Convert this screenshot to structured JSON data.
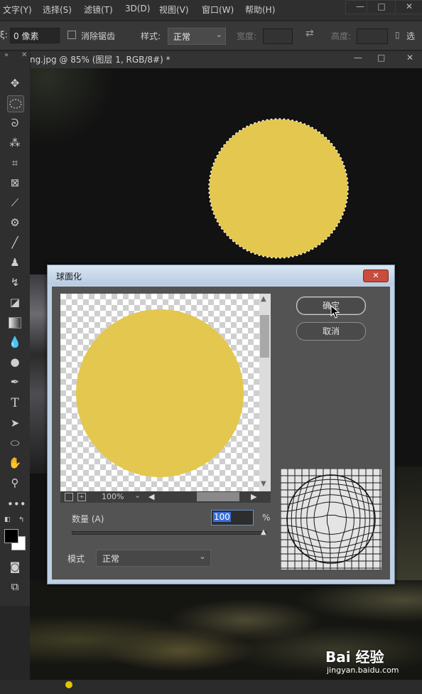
{
  "menubar": {
    "items": [
      "文字(Y)",
      "选择(S)",
      "滤镜(T)",
      "3D(D)",
      "视图(V)",
      "窗口(W)",
      "帮助(H)"
    ],
    "window_controls": [
      "—",
      "□",
      "✕"
    ]
  },
  "options": {
    "feather_label": "ξ:",
    "feather_value": "0 像素",
    "antialias_label": "消除锯齿",
    "style_label": "样式:",
    "style_value": "正常",
    "width_label": "宽度:",
    "height_label": "高度:",
    "select_label": "选"
  },
  "document_tab": {
    "title": "ng.jpg @ 85% (图层 1, RGB/8#) *",
    "window_controls": [
      "—",
      "□",
      "✕"
    ]
  },
  "toolbar": {
    "expand": "» ",
    "tools": [
      "move",
      "elliptical-marquee",
      "lasso",
      "magic-wand",
      "crop",
      "frame",
      "eyedropper",
      "healing-brush",
      "brush",
      "clone-stamp",
      "history-brush",
      "eraser",
      "gradient",
      "blur",
      "dodge",
      "pen",
      "type",
      "path-selection",
      "ellipse-shape",
      "hand",
      "zoom",
      "more",
      "default-colors",
      "swap-colors",
      "foreground-color",
      "background-color",
      "quick-mask",
      "screen-mode"
    ],
    "type_glyph": "T"
  },
  "colors": {
    "moon": "#e3c74f",
    "foreground": "#000000",
    "background": "#ffffff",
    "dialog_titlebar": "#c4d4e8",
    "close_button": "#c94c3c"
  },
  "dialog": {
    "title": "球面化",
    "close": "✕",
    "ok_label": "确定",
    "cancel_label": "取消",
    "zoom_value": "100%",
    "amount_label": "数量 (A)",
    "amount_value": "100",
    "amount_unit": "%",
    "amount_slider_fraction": 1.0,
    "mode_label": "模式",
    "mode_value": "正常"
  },
  "watermark": {
    "brand": "Bai 经验",
    "url": "jingyan.baidu.com"
  }
}
